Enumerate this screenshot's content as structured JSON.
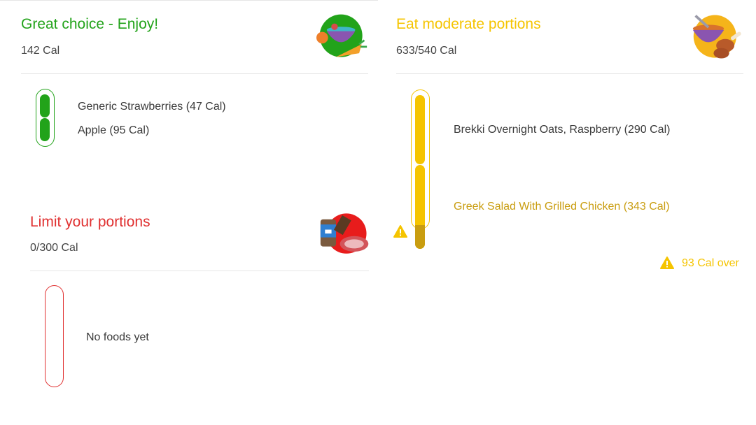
{
  "colors": {
    "green": "#22a31a",
    "yellow": "#f5c400",
    "yellow_dark": "#c99d10",
    "red": "#e03030"
  },
  "great": {
    "title": "Great choice - Enjoy!",
    "calories": "142 Cal",
    "icon": "bowl-vegetables-icon",
    "foods": [
      "Generic Strawberries (47 Cal)",
      "Apple (95 Cal)"
    ]
  },
  "limit": {
    "title": "Limit your portions",
    "calories": "0/300 Cal",
    "icon": "meat-chocolate-icon",
    "empty_text": "No foods yet"
  },
  "moderate": {
    "title": "Eat moderate portions",
    "calories": "633/540 Cal",
    "icon": "bowl-chicken-icon",
    "foods": [
      "Brekki Overnight Oats, Raspberry (290 Cal)",
      "Greek Salad With Grilled Chicken (343 Cal)"
    ],
    "over_text": "93 Cal over"
  }
}
